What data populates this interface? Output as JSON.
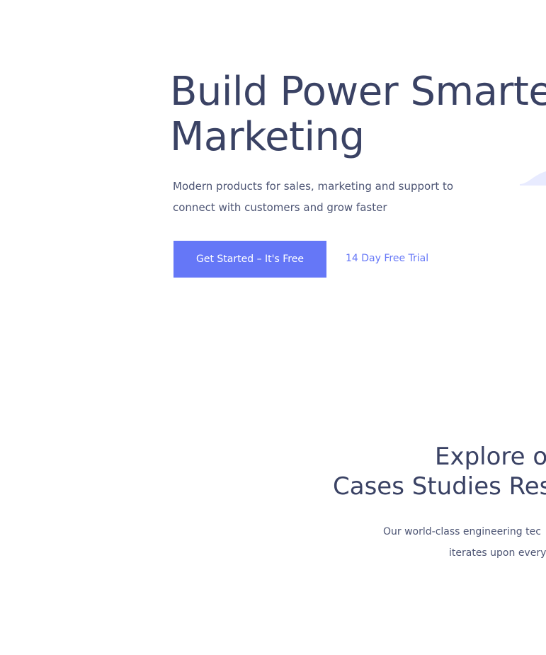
{
  "hero": {
    "title_line1": "Build Power Smarter",
    "title_line2": "Marketing",
    "subtitle_line1": "Modern products for sales, marketing and support to",
    "subtitle_line2": "connect with customers and grow faster",
    "primary_button": "Get Started – It's Free",
    "secondary_link": "14 Day Free Trial"
  },
  "section": {
    "title_line1": "Explore ou",
    "title_line2": "Cases Studies Res",
    "text_line1": "Our world-class engineering tec",
    "text_line2": "iterates upon every"
  },
  "colors": {
    "heading": "#3a4264",
    "body": "#4d5574",
    "accent": "#6577f7",
    "background": "#ffffff",
    "decoration": "#e8ebff"
  }
}
